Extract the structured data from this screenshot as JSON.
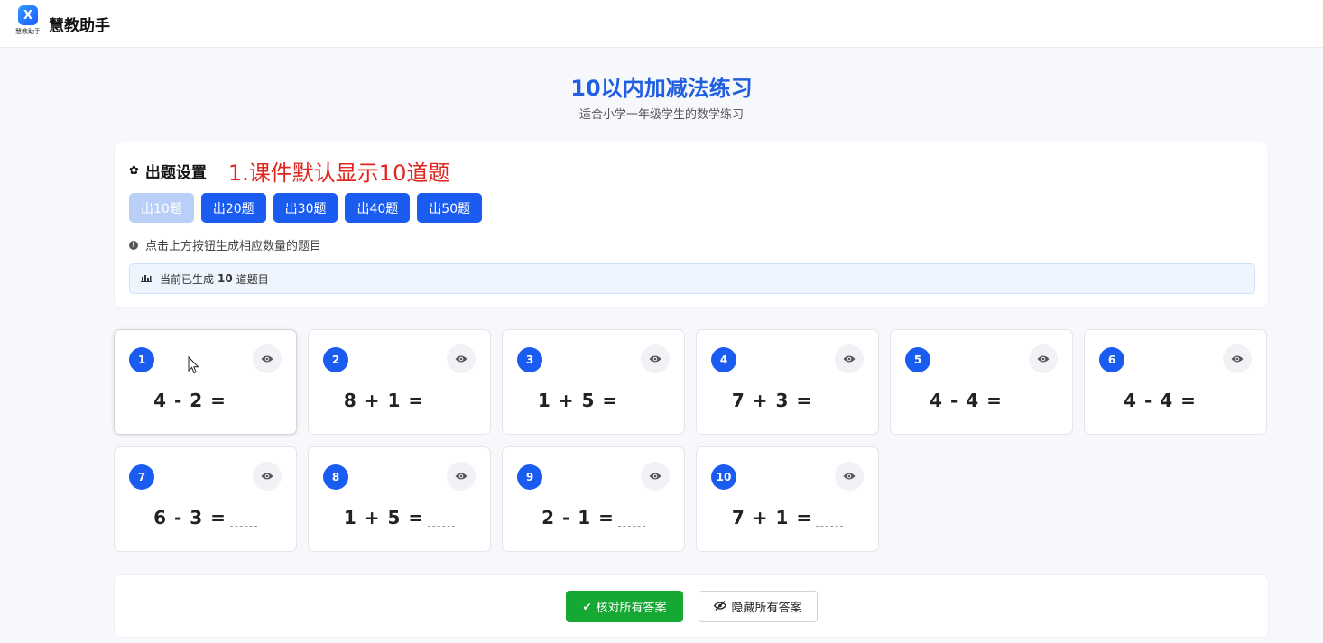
{
  "header": {
    "logo_mark": "X",
    "logo_caption": "慧教助手",
    "brand_name": "慧教助手"
  },
  "page": {
    "title": "10以内加减法练习",
    "subtitle": "适合小学一年级学生的数学练习"
  },
  "settings": {
    "title": "出题设置",
    "annotation": "1.课件默认显示10道题",
    "buttons": [
      {
        "label": "出10题",
        "active": true
      },
      {
        "label": "出20题",
        "active": false
      },
      {
        "label": "出30题",
        "active": false
      },
      {
        "label": "出40题",
        "active": false
      },
      {
        "label": "出50题",
        "active": false
      }
    ],
    "hint": "点击上方按钮生成相应数量的题目",
    "status_prefix": "当前已生成",
    "status_count": "10",
    "status_suffix": "道题目"
  },
  "problems": [
    {
      "index": "1",
      "expression": "4 - 2 ="
    },
    {
      "index": "2",
      "expression": "8 + 1 ="
    },
    {
      "index": "3",
      "expression": "1 + 5 ="
    },
    {
      "index": "4",
      "expression": "7 + 3 ="
    },
    {
      "index": "5",
      "expression": "4 - 4 ="
    },
    {
      "index": "6",
      "expression": "4 - 4 ="
    },
    {
      "index": "7",
      "expression": "6 - 3 ="
    },
    {
      "index": "8",
      "expression": "1 + 5 ="
    },
    {
      "index": "9",
      "expression": "2 - 1 ="
    },
    {
      "index": "10",
      "expression": "7 + 1 ="
    }
  ],
  "footer": {
    "check_label": "核对所有答案",
    "hide_label": "隐藏所有答案"
  },
  "colors": {
    "primary": "#1b5cf0",
    "title": "#1f5fe0",
    "annotation": "#e0261e",
    "success": "#15a832"
  },
  "icons": {
    "settings": "gear-icon",
    "hint": "info-icon",
    "status": "bar-chart-icon",
    "card_toggle": "eye-icon",
    "check": "checkmark-icon",
    "hide": "eye-slash-icon"
  }
}
